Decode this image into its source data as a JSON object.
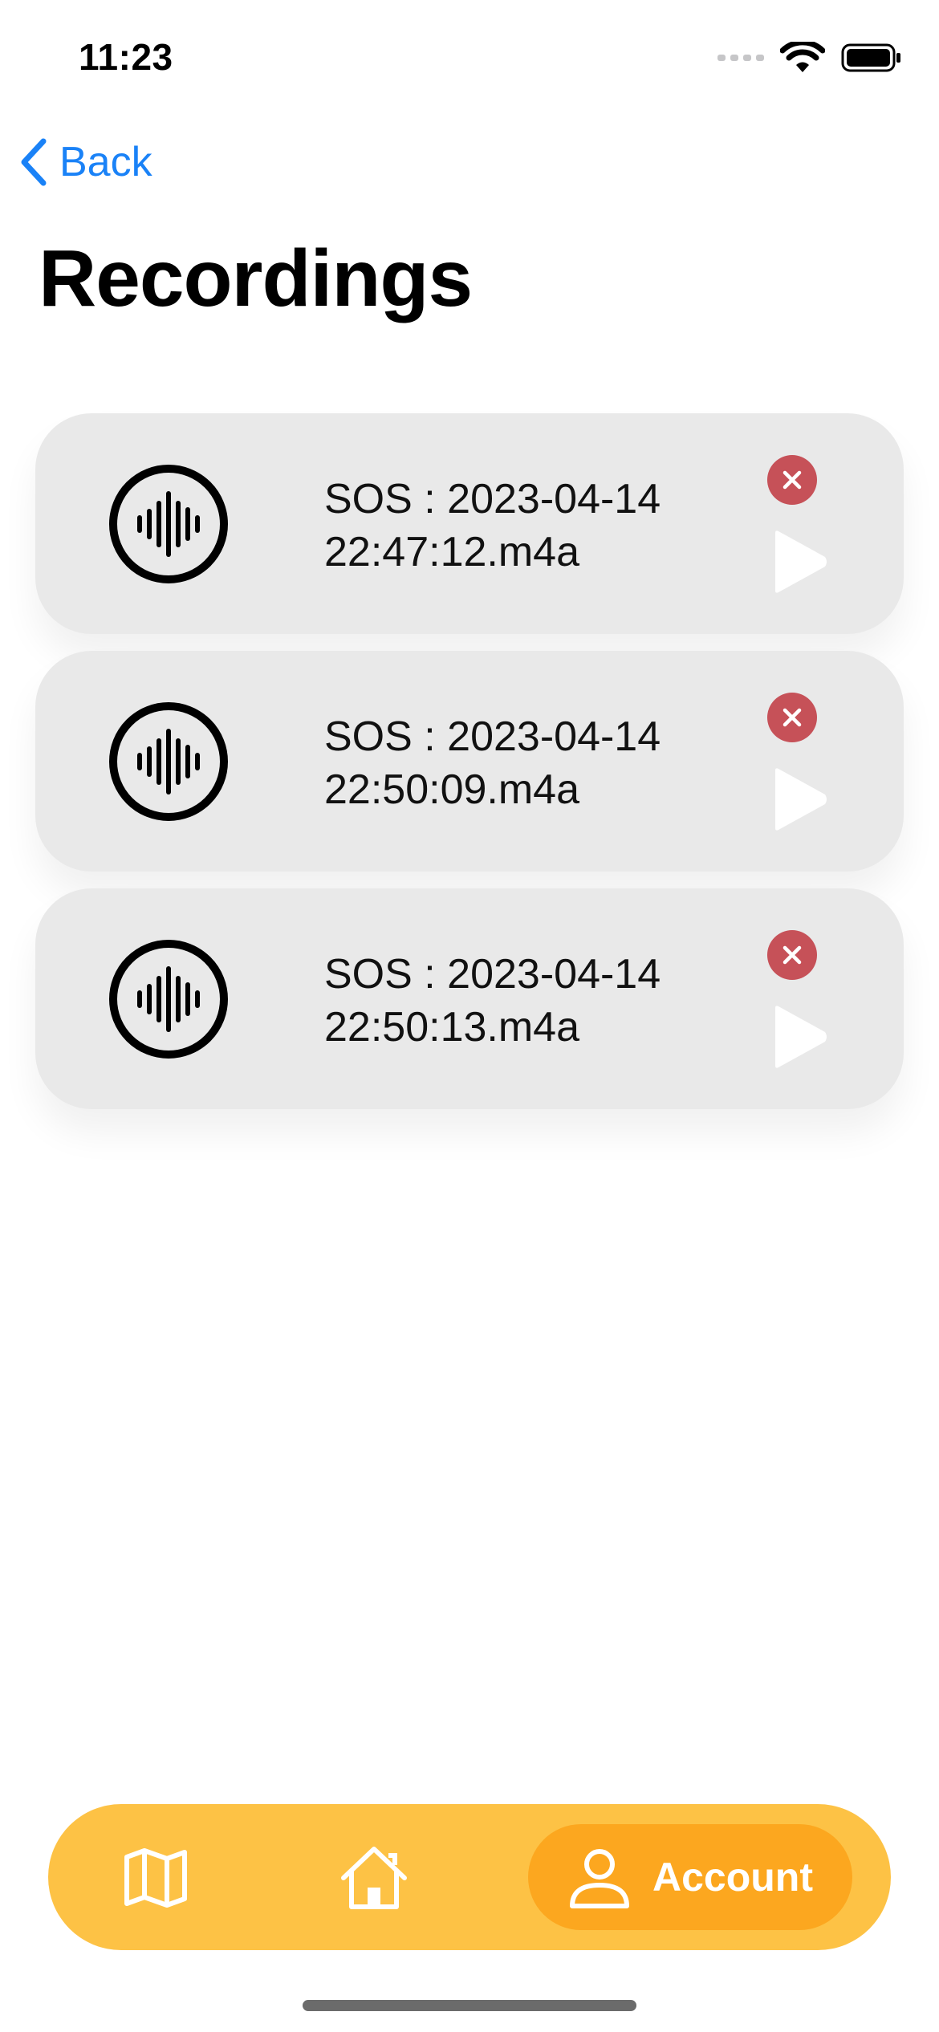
{
  "status_bar": {
    "time": "11:23"
  },
  "nav": {
    "back_label": "Back"
  },
  "page": {
    "title": "Recordings"
  },
  "recordings": [
    {
      "name": "SOS : 2023-04-14 22:47:12.m4a"
    },
    {
      "name": "SOS : 2023-04-14 22:50:09.m4a"
    },
    {
      "name": "SOS : 2023-04-14 22:50:13.m4a"
    }
  ],
  "tabbar": {
    "active_tab": "account",
    "account_label": "Account",
    "icons": [
      "map-icon",
      "home-icon",
      "person-icon"
    ]
  },
  "colors": {
    "accent_blue": "#1a82f7",
    "card_bg": "#e9e9e9",
    "delete_red": "#c65158",
    "tabbar_bg": "#fdc245",
    "tab_active_bg": "#fca71f"
  }
}
